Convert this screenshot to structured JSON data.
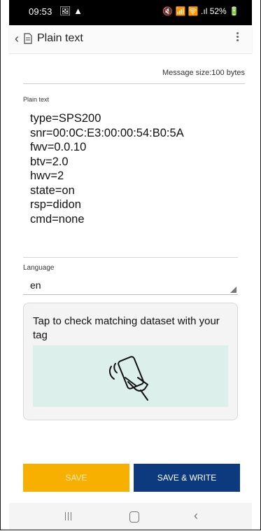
{
  "status_bar": {
    "time": "09:53",
    "left_icons": "🖼 ▲",
    "right_icons": "🔇 📶 🛜 .ıl 52% 🔋"
  },
  "app_bar": {
    "back_glyph": "‹",
    "title": "Plain text"
  },
  "content": {
    "message_size": "Message size:100 bytes",
    "plain_text_label": "Plain text",
    "plain_text_lines": [
      "type=SPS200",
      "snr=00:0C:E3:00:00:54:B0:5A",
      "fwv=0.0.10",
      "btv=2.0",
      "hwv=2",
      "state=on",
      "rsp=didon",
      "cmd=none"
    ],
    "language_label": "Language",
    "language_value": "en",
    "card_text": "Tap to check matching dataset with your tag"
  },
  "buttons": {
    "save": "SAVE",
    "save_write": "SAVE & WRITE"
  },
  "colors": {
    "save_bg": "#f7b000",
    "save_write_bg": "#0d3a7e",
    "illustration_bg": "#dcefeb"
  }
}
